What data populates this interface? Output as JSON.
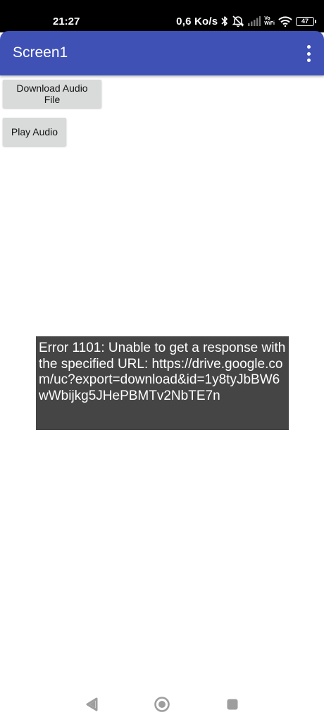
{
  "status_bar": {
    "time": "21:27",
    "network_speed": "0,6 Ko/s",
    "vowifi_top": "Vo",
    "vowifi_bottom": "WiFi",
    "battery_level": "47",
    "icons": [
      "bluetooth-icon",
      "mute-icon",
      "signal-icon",
      "wifi-icon",
      "battery-icon"
    ]
  },
  "app_bar": {
    "title": "Screen1",
    "background_color": "#3f51b5",
    "menu_icon": "overflow-menu-icon"
  },
  "buttons": {
    "download_label": "Download Audio File",
    "play_label": "Play Audio"
  },
  "toast": {
    "message": "Error 1101: Unable to get a response with the specified URL: https://drive.google.com/uc?export=download&id=1y8tyJbBW6wWbijkg5JHePBMTv2NbTE7n"
  },
  "nav_bar": {
    "icons": [
      "back-icon",
      "home-icon",
      "recents-icon"
    ]
  }
}
